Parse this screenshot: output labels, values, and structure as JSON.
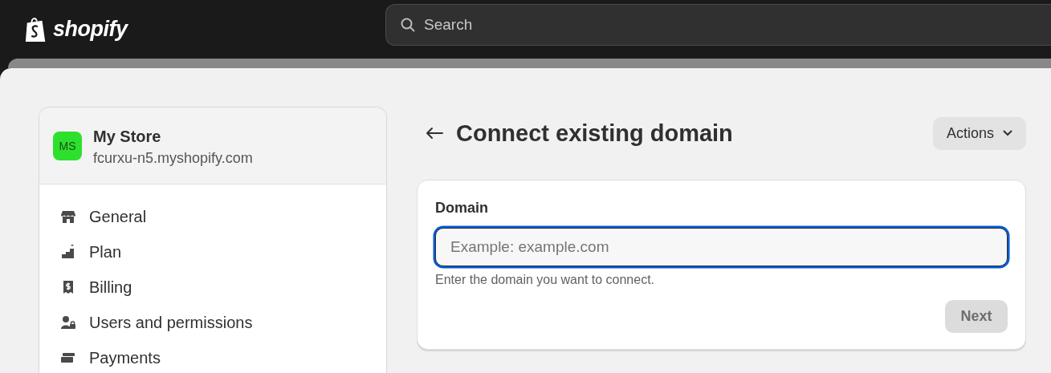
{
  "topbar": {
    "logo_text": "shopify",
    "search": {
      "placeholder": "Search"
    }
  },
  "store": {
    "initials": "MS",
    "name": "My Store",
    "domain": "fcurxu-n5.myshopify.com"
  },
  "sidebar": {
    "items": [
      {
        "label": "General"
      },
      {
        "label": "Plan"
      },
      {
        "label": "Billing"
      },
      {
        "label": "Users and permissions"
      },
      {
        "label": "Payments"
      }
    ]
  },
  "page": {
    "title": "Connect existing domain",
    "actions": "Actions"
  },
  "form": {
    "label": "Domain",
    "placeholder": "Example: example.com",
    "focused": true,
    "help": "Enter the domain you want to connect.",
    "next": {
      "label": "Next",
      "disabled": true
    }
  }
}
